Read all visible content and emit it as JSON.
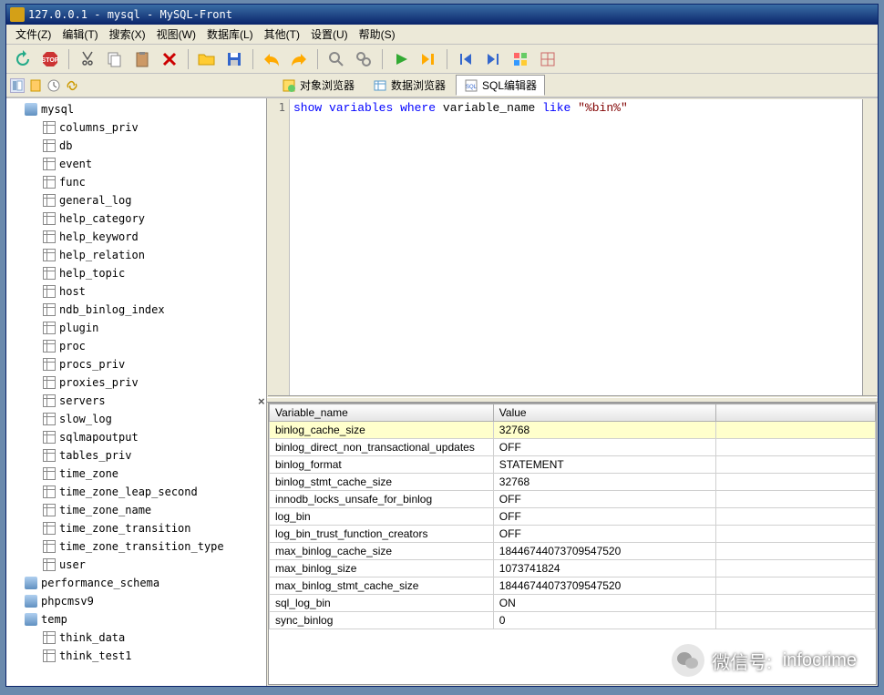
{
  "window": {
    "title": "127.0.0.1 - mysql - MySQL-Front"
  },
  "menu": {
    "file": "文件(Z)",
    "edit": "编辑(T)",
    "search": "搜索(X)",
    "view": "视图(W)",
    "database": "数据库(L)",
    "other": "其他(T)",
    "settings": "设置(U)",
    "help": "帮助(S)"
  },
  "tabs": {
    "object_browser": "对象浏览器",
    "data_browser": "数据浏览器",
    "sql_editor": "SQL编辑器"
  },
  "tree": {
    "databases": [
      {
        "name": "mysql",
        "icon": "db",
        "level": 1
      },
      {
        "name": "columns_priv",
        "icon": "table",
        "level": 2
      },
      {
        "name": "db",
        "icon": "table",
        "level": 2
      },
      {
        "name": "event",
        "icon": "table",
        "level": 2
      },
      {
        "name": "func",
        "icon": "table",
        "level": 2
      },
      {
        "name": "general_log",
        "icon": "table",
        "level": 2
      },
      {
        "name": "help_category",
        "icon": "table",
        "level": 2
      },
      {
        "name": "help_keyword",
        "icon": "table",
        "level": 2
      },
      {
        "name": "help_relation",
        "icon": "table",
        "level": 2
      },
      {
        "name": "help_topic",
        "icon": "table",
        "level": 2
      },
      {
        "name": "host",
        "icon": "table",
        "level": 2
      },
      {
        "name": "ndb_binlog_index",
        "icon": "table",
        "level": 2
      },
      {
        "name": "plugin",
        "icon": "table",
        "level": 2
      },
      {
        "name": "proc",
        "icon": "table",
        "level": 2
      },
      {
        "name": "procs_priv",
        "icon": "table",
        "level": 2
      },
      {
        "name": "proxies_priv",
        "icon": "table",
        "level": 2
      },
      {
        "name": "servers",
        "icon": "table",
        "level": 2
      },
      {
        "name": "slow_log",
        "icon": "table",
        "level": 2
      },
      {
        "name": "sqlmapoutput",
        "icon": "table",
        "level": 2
      },
      {
        "name": "tables_priv",
        "icon": "table",
        "level": 2
      },
      {
        "name": "time_zone",
        "icon": "table",
        "level": 2
      },
      {
        "name": "time_zone_leap_second",
        "icon": "table",
        "level": 2
      },
      {
        "name": "time_zone_name",
        "icon": "table",
        "level": 2
      },
      {
        "name": "time_zone_transition",
        "icon": "table",
        "level": 2
      },
      {
        "name": "time_zone_transition_type",
        "icon": "table",
        "level": 2
      },
      {
        "name": "user",
        "icon": "table",
        "level": 2
      },
      {
        "name": "performance_schema",
        "icon": "db",
        "level": 1
      },
      {
        "name": "phpcmsv9",
        "icon": "db",
        "level": 1
      },
      {
        "name": "temp",
        "icon": "db",
        "level": 1
      },
      {
        "name": "think_data",
        "icon": "table",
        "level": 2
      },
      {
        "name": "think_test1",
        "icon": "table",
        "level": 2
      }
    ]
  },
  "editor": {
    "line_num": "1",
    "kw_show": "show",
    "kw_variables": "variables",
    "kw_where": "where",
    "ident_varname": "variable_name",
    "kw_like": "like",
    "str_val": "\"%bin%\""
  },
  "results": {
    "headers": [
      "Variable_name",
      "Value"
    ],
    "rows": [
      {
        "name": "binlog_cache_size",
        "value": "32768",
        "selected": true
      },
      {
        "name": "binlog_direct_non_transactional_updates",
        "value": "OFF"
      },
      {
        "name": "binlog_format",
        "value": "STATEMENT"
      },
      {
        "name": "binlog_stmt_cache_size",
        "value": "32768"
      },
      {
        "name": "innodb_locks_unsafe_for_binlog",
        "value": "OFF"
      },
      {
        "name": "log_bin",
        "value": "OFF"
      },
      {
        "name": "log_bin_trust_function_creators",
        "value": "OFF"
      },
      {
        "name": "max_binlog_cache_size",
        "value": "18446744073709547520"
      },
      {
        "name": "max_binlog_size",
        "value": "1073741824"
      },
      {
        "name": "max_binlog_stmt_cache_size",
        "value": "18446744073709547520"
      },
      {
        "name": "sql_log_bin",
        "value": "ON"
      },
      {
        "name": "sync_binlog",
        "value": "0"
      }
    ]
  },
  "watermark": {
    "label": "微信号:",
    "account": "infocrime"
  }
}
